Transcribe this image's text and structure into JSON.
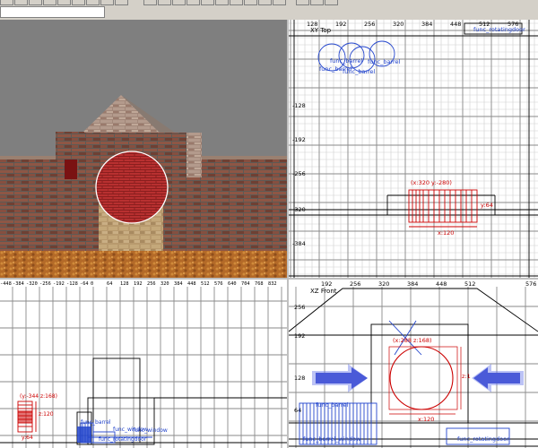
{
  "viewports": {
    "xy_top": {
      "label": "XY Top",
      "ticks_x": [
        "128",
        "192",
        "256",
        "320",
        "384",
        "448",
        "512",
        "576"
      ],
      "ticks_y": [
        "-128",
        "-192",
        "-256",
        "-320",
        "-384"
      ],
      "entities": {
        "rotating_door": "func_rotatingdoor",
        "barrel_1": "func_barrel",
        "barrel_2": "func_barrel",
        "barrel_3": "func_barrel",
        "barrel_4": "func_barrel"
      },
      "selection": {
        "coords": "(x:320  y:-280)",
        "height": "y:64",
        "width": "x:120"
      }
    },
    "xz_front": {
      "label": "XZ Front",
      "ticks_x": [
        "192",
        "256",
        "320",
        "384",
        "448",
        "512",
        "576"
      ],
      "ticks_y": [
        "256",
        "192",
        "128",
        "64"
      ],
      "entities": {
        "barrel": "func_barrel",
        "barrel_window": "func_barrel_window",
        "rotating_door": "func_rotatingdoor"
      },
      "selection": {
        "coords": "(x:288  z:168)",
        "height": "z:1",
        "width": "x:120"
      }
    },
    "side": {
      "ticks_x": [
        "-448",
        "-384",
        "-320",
        "-256",
        "-192",
        "-128",
        "-64",
        "0",
        "64",
        "128",
        "192",
        "256",
        "320",
        "384",
        "448",
        "512",
        "576",
        "640",
        "704",
        "768",
        "832"
      ],
      "entities": {
        "barrel": "func_barrel",
        "window": "func_window",
        "window_2": "func_window",
        "rotating_door": "func_rotatingdoor"
      },
      "selection": {
        "coords": "(y:-344  z:168)",
        "height": "z:120",
        "width": "y:64"
      }
    }
  },
  "colors": {
    "grid_bg": "#ffffff",
    "grid_line": "#c8c8c8",
    "grid_major": "#8a8a8a",
    "selection": "#cc0000",
    "entity": "#2244cc",
    "arrow": "#4a5ad8",
    "sky": "#7f7f7f"
  }
}
